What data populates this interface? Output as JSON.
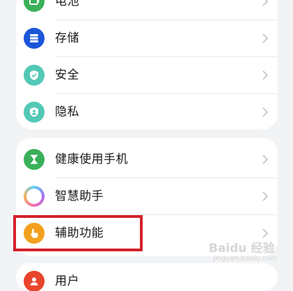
{
  "settings": {
    "group1": [
      {
        "label": "电池",
        "icon": "battery-icon",
        "color": "#3ab05a"
      },
      {
        "label": "存储",
        "icon": "storage-icon",
        "color": "#1a56d9"
      },
      {
        "label": "安全",
        "icon": "security-shield-icon",
        "color": "#53c8b6"
      },
      {
        "label": "隐私",
        "icon": "privacy-icon",
        "color": "#53c8b6"
      }
    ],
    "group2": [
      {
        "label": "健康使用手机",
        "icon": "hourglass-icon",
        "color": "#3ab05a"
      },
      {
        "label": "智慧助手",
        "icon": "smart-assistant-icon",
        "color": "#a56cf0"
      },
      {
        "label": "辅助功能",
        "icon": "accessibility-hand-icon",
        "color": "#f2a01e"
      }
    ],
    "group3": [
      {
        "label": "用户",
        "icon": "user-icon",
        "color": "#e8452c"
      }
    ]
  },
  "highlight_color": "#d3222a",
  "watermark": {
    "text": "Baidu 经验",
    "sub": "jingyan.baidu.com"
  }
}
